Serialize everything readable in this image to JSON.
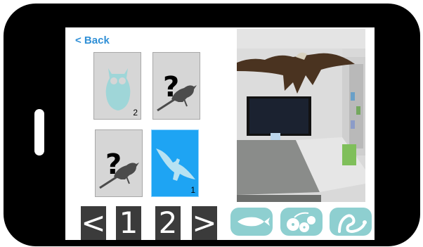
{
  "back_label": "< Back",
  "cards": [
    {
      "id": "owl",
      "icon": "owl-icon",
      "count": "2",
      "selected": false
    },
    {
      "id": "unknown-1",
      "icon": "unknown-bird-icon",
      "count": "",
      "selected": false
    },
    {
      "id": "unknown-2",
      "icon": "unknown-bird-icon",
      "count": "",
      "selected": false
    },
    {
      "id": "eagle",
      "icon": "eagle-icon",
      "count": "1",
      "selected": true
    }
  ],
  "pagination": {
    "prev": "<",
    "pages": [
      "1",
      "2"
    ],
    "next": ">"
  },
  "categories": [
    {
      "name": "fish",
      "icon": "fish-icon"
    },
    {
      "name": "plants",
      "icon": "berries-icon"
    },
    {
      "name": "reptiles",
      "icon": "snake-icon"
    }
  ],
  "colors": {
    "accent": "#1ea4f3",
    "category_button": "#8ecfd0",
    "back_link": "#2f8fd6"
  }
}
